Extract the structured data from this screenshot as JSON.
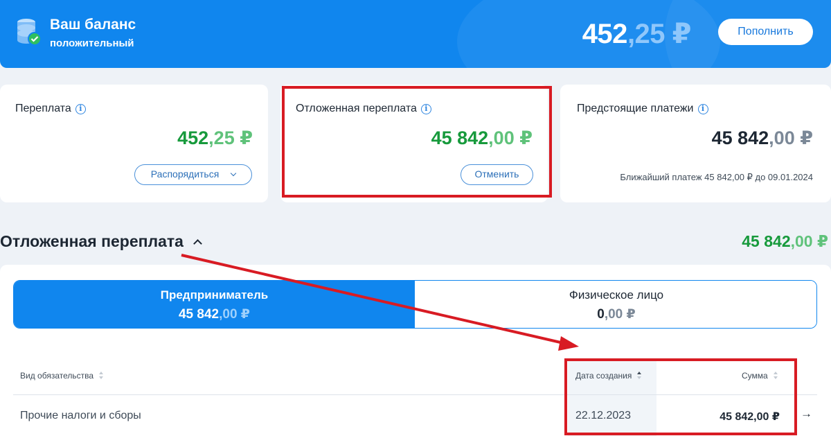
{
  "header": {
    "title": "Ваш баланс",
    "subtitle": "положительный",
    "balance_int": "452",
    "balance_frac": ",25 ₽",
    "topup_label": "Пополнить"
  },
  "cards": {
    "overpay": {
      "label": "Переплата",
      "amount_int": "452",
      "amount_frac": ",25 ₽",
      "button_label": "Распорядиться"
    },
    "deferred": {
      "label": "Отложенная переплата",
      "amount_int": "45 842",
      "amount_frac": ",00 ₽",
      "button_label": "Отменить"
    },
    "upcoming": {
      "label": "Предстоящие платежи",
      "amount_int": "45 842",
      "amount_frac": ",00 ₽",
      "note": "Ближайший платеж 45 842,00 ₽ до 09.01.2024"
    }
  },
  "section": {
    "title": "Отложенная переплата",
    "amount_int": "45 842",
    "amount_frac": ",00 ₽"
  },
  "tabs": [
    {
      "label": "Предприниматель",
      "amount_int": "45 842",
      "amount_frac": ",00 ₽",
      "active": true
    },
    {
      "label": "Физическое лицо",
      "amount_int": "0",
      "amount_frac": ",00 ₽",
      "active": false
    }
  ],
  "table": {
    "columns": [
      "Вид обязательства",
      "Дата создания",
      "Сумма"
    ],
    "rows": [
      {
        "type": "Прочие налоги и сборы",
        "date": "22.12.2023",
        "sum": "45 842,00 ₽",
        "arrow": "→"
      }
    ]
  },
  "colors": {
    "brand_blue": "#1086ee",
    "positive_green": "#179a3c",
    "highlight_red": "#d81b23"
  }
}
